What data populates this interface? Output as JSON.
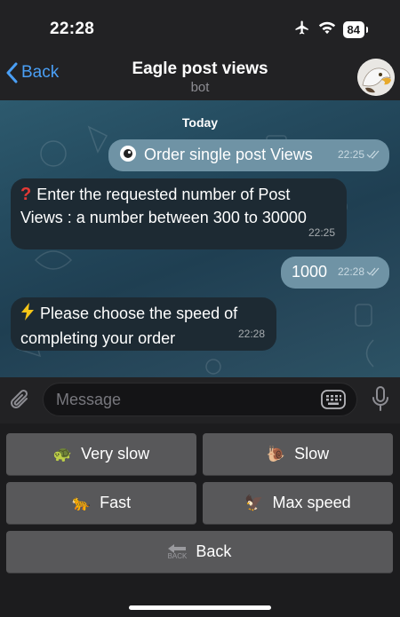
{
  "status_bar": {
    "time": "22:28",
    "battery": "84",
    "icons": [
      "airplane-icon",
      "wifi-icon",
      "battery-icon"
    ]
  },
  "nav": {
    "back_label": "Back",
    "title": "Eagle post views",
    "subtitle": "bot",
    "accent_color": "#4a9ff5"
  },
  "chat": {
    "date_label": "Today",
    "messages": [
      {
        "direction": "out",
        "icon": "eye-icon",
        "text": "Order single post Views",
        "time": "22:25",
        "status": "read"
      },
      {
        "direction": "in",
        "icon": "question-icon",
        "text_line1": "Enter the requested number of Post",
        "text_line2": "Views : a number between 300 to 30000",
        "time": "22:25"
      },
      {
        "direction": "out",
        "text": "1000",
        "time": "22:28",
        "status": "read"
      },
      {
        "direction": "in",
        "icon": "lightning-icon",
        "text_line1": "Please choose the speed of",
        "text_line2": "completing your order",
        "time": "22:28"
      }
    ]
  },
  "composer": {
    "placeholder": "Message"
  },
  "keyboard": {
    "buttons": [
      {
        "label": "Very slow",
        "icon": "turtle-icon",
        "emoji": "🐢"
      },
      {
        "label": "Slow",
        "icon": "snail-icon",
        "emoji": "🐌"
      },
      {
        "label": "Fast",
        "icon": "leopard-icon",
        "emoji": "🐆"
      },
      {
        "label": "Max speed",
        "icon": "eagle-icon",
        "emoji": "🦅"
      },
      {
        "label": "Back",
        "icon": "back-arrow-icon",
        "badge_text": "BACK"
      }
    ]
  }
}
